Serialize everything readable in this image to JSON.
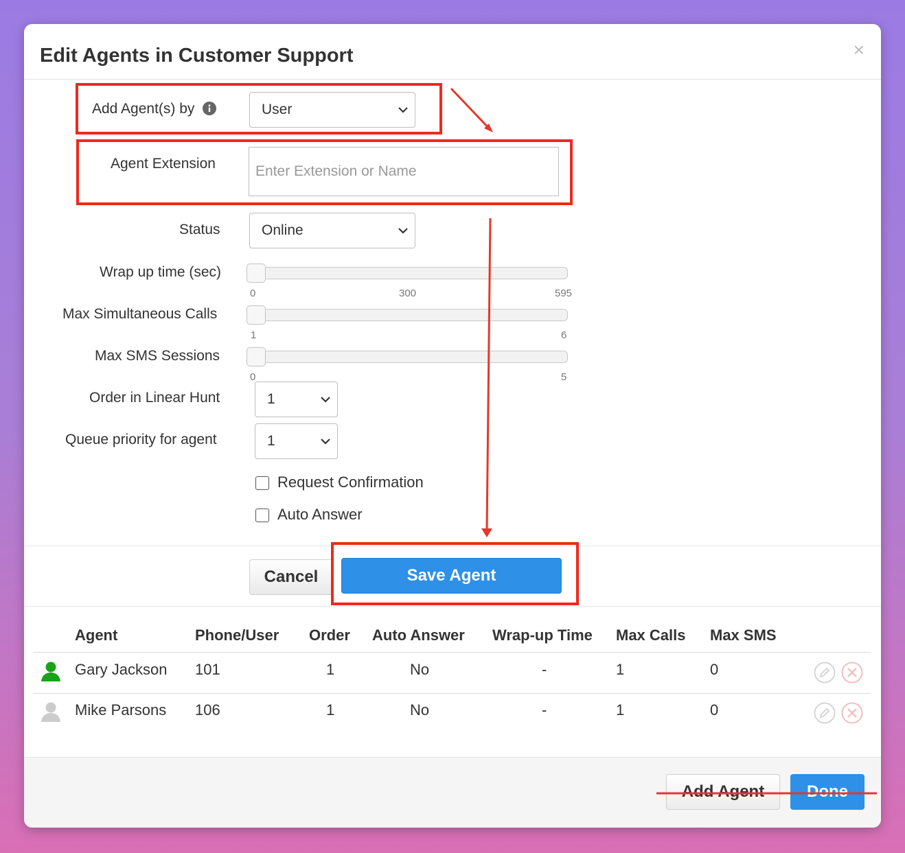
{
  "dialog": {
    "title": "Edit Agents in Customer Support",
    "close_glyph": "×"
  },
  "form": {
    "add_by_label": "Add Agent(s) by",
    "add_by_value": "User",
    "agent_extension_label": "Agent Extension",
    "agent_extension_placeholder": "Enter Extension or Name",
    "status_label": "Status",
    "status_value": "Online",
    "wrapup_label": "Wrap up time (sec)",
    "wrapup_ticks": [
      "0",
      "300",
      "595"
    ],
    "wrapup_value": 0,
    "max_calls_label": "Max Simultaneous Calls",
    "max_calls_ticks": [
      "1",
      "6"
    ],
    "max_calls_value": 1,
    "max_sms_label": "Max SMS Sessions",
    "max_sms_ticks": [
      "0",
      "5"
    ],
    "max_sms_value": 0,
    "order_label": "Order in Linear Hunt",
    "order_value": "1",
    "queue_priority_label": "Queue priority for agent",
    "queue_priority_value": "1",
    "request_confirmation_label": "Request Confirmation",
    "auto_answer_label": "Auto Answer",
    "cancel_label": "Cancel",
    "save_label": "Save Agent"
  },
  "table": {
    "headers": [
      "Agent",
      "Phone/User",
      "Order",
      "Auto Answer",
      "Wrap-up Time",
      "Max Calls",
      "Max SMS"
    ],
    "rows": [
      {
        "name": "Gary Jackson",
        "phone": "101",
        "order": "1",
        "auto_answer": "No",
        "wrapup": "-",
        "max_calls": "1",
        "max_sms": "0",
        "status_color": "#1aa31a"
      },
      {
        "name": "Mike Parsons",
        "phone": "106",
        "order": "1",
        "auto_answer": "No",
        "wrapup": "-",
        "max_calls": "1",
        "max_sms": "0",
        "status_color": "#cccccc"
      }
    ]
  },
  "footer": {
    "add_agent_label": "Add Agent",
    "done_label": "Done"
  },
  "colors": {
    "accent": "#2e90e6",
    "annotation": "#ee2a1b"
  }
}
